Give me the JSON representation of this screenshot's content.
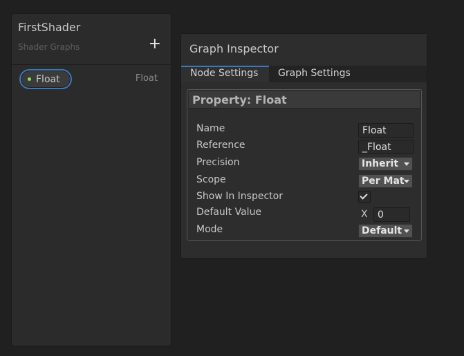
{
  "blackboard": {
    "title": "FirstShader",
    "subtitle": "Shader Graphs",
    "add_icon": "+",
    "properties": [
      {
        "label": "Float",
        "type": "Float",
        "dot_color": "#84e45a"
      }
    ]
  },
  "inspector": {
    "title": "Graph Inspector",
    "tabs": [
      {
        "label": "Node Settings",
        "active": true
      },
      {
        "label": "Graph Settings",
        "active": false
      }
    ],
    "panel_title": "Property: Float",
    "fields": {
      "name": {
        "label": "Name",
        "value": "Float"
      },
      "reference": {
        "label": "Reference",
        "value": "_Float"
      },
      "precision": {
        "label": "Precision",
        "value": "Inherit"
      },
      "scope": {
        "label": "Scope",
        "value": "Per Material"
      },
      "show_in_inspector": {
        "label": "Show In Inspector",
        "checked": true
      },
      "default_value": {
        "label": "Default Value",
        "axis": "X",
        "value": "0"
      },
      "mode": {
        "label": "Mode",
        "value": "Default"
      }
    }
  },
  "colors": {
    "accent": "#3a79bb",
    "float_dot": "#84e45a",
    "background": "#202020"
  }
}
